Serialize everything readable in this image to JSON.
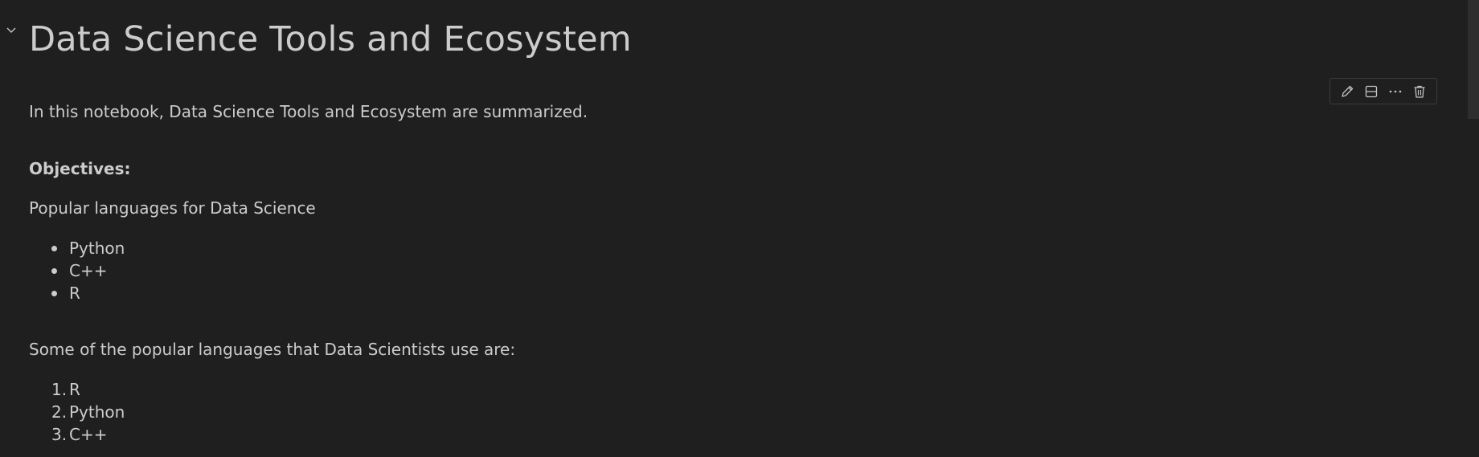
{
  "notebook": {
    "title": "Data Science Tools and Ecosystem",
    "intro": "In this notebook, Data Science Tools and Ecosystem are summarized.",
    "objectives_label": "Objectives:",
    "popular_heading": "Popular languages for Data Science",
    "popular_list": [
      "Python",
      "C++",
      "R"
    ],
    "some_heading": "Some of the popular languages that Data Scientists use are:",
    "numbered_list": [
      "R",
      "Python",
      "C++"
    ]
  },
  "toolbar": {
    "buttons": [
      "edit-icon",
      "split-cell-icon",
      "more-actions-icon",
      "delete-icon"
    ]
  },
  "colors": {
    "background": "#1f1f1f",
    "text": "#cccccc",
    "toolbar_border": "#3c3c3c"
  }
}
